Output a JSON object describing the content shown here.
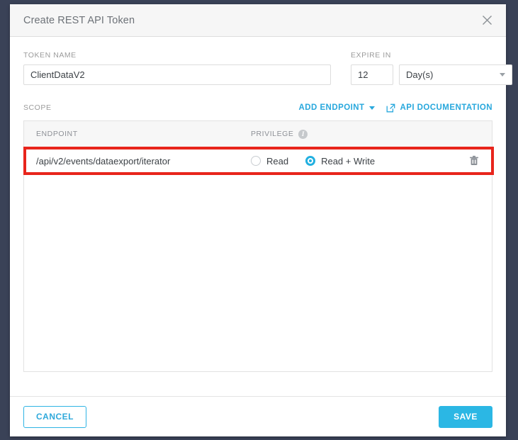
{
  "dialog": {
    "title": "Create REST API Token",
    "close_icon": "close-icon"
  },
  "form": {
    "token_name_label": "TOKEN NAME",
    "token_name_value": "ClientDataV2",
    "token_name_placeholder": "",
    "expire_label": "EXPIRE IN",
    "expire_value": "12",
    "expire_unit_selected": "Day(s)",
    "expire_unit_options": [
      "Day(s)"
    ]
  },
  "scope": {
    "label": "SCOPE",
    "add_endpoint_label": "ADD ENDPOINT",
    "api_documentation_label": "API DOCUMENTATION",
    "columns": {
      "endpoint": "ENDPOINT",
      "privilege": "PRIVILEGE",
      "privilege_info_tooltip": "i"
    },
    "rows": [
      {
        "endpoint": "/api/v2/events/dataexport/iterator",
        "privileges": [
          {
            "label": "Read",
            "selected": false
          },
          {
            "label": "Read + Write",
            "selected": true
          }
        ],
        "delete_icon": "trash-icon",
        "highlighted": true
      }
    ]
  },
  "footer": {
    "cancel_label": "CANCEL",
    "save_label": "SAVE"
  },
  "colors": {
    "accent": "#2bb7e4",
    "link": "#28a8dd",
    "highlight": "#e8251c",
    "header_bg": "#f6f6f6",
    "page_bg": "#3a4257"
  }
}
